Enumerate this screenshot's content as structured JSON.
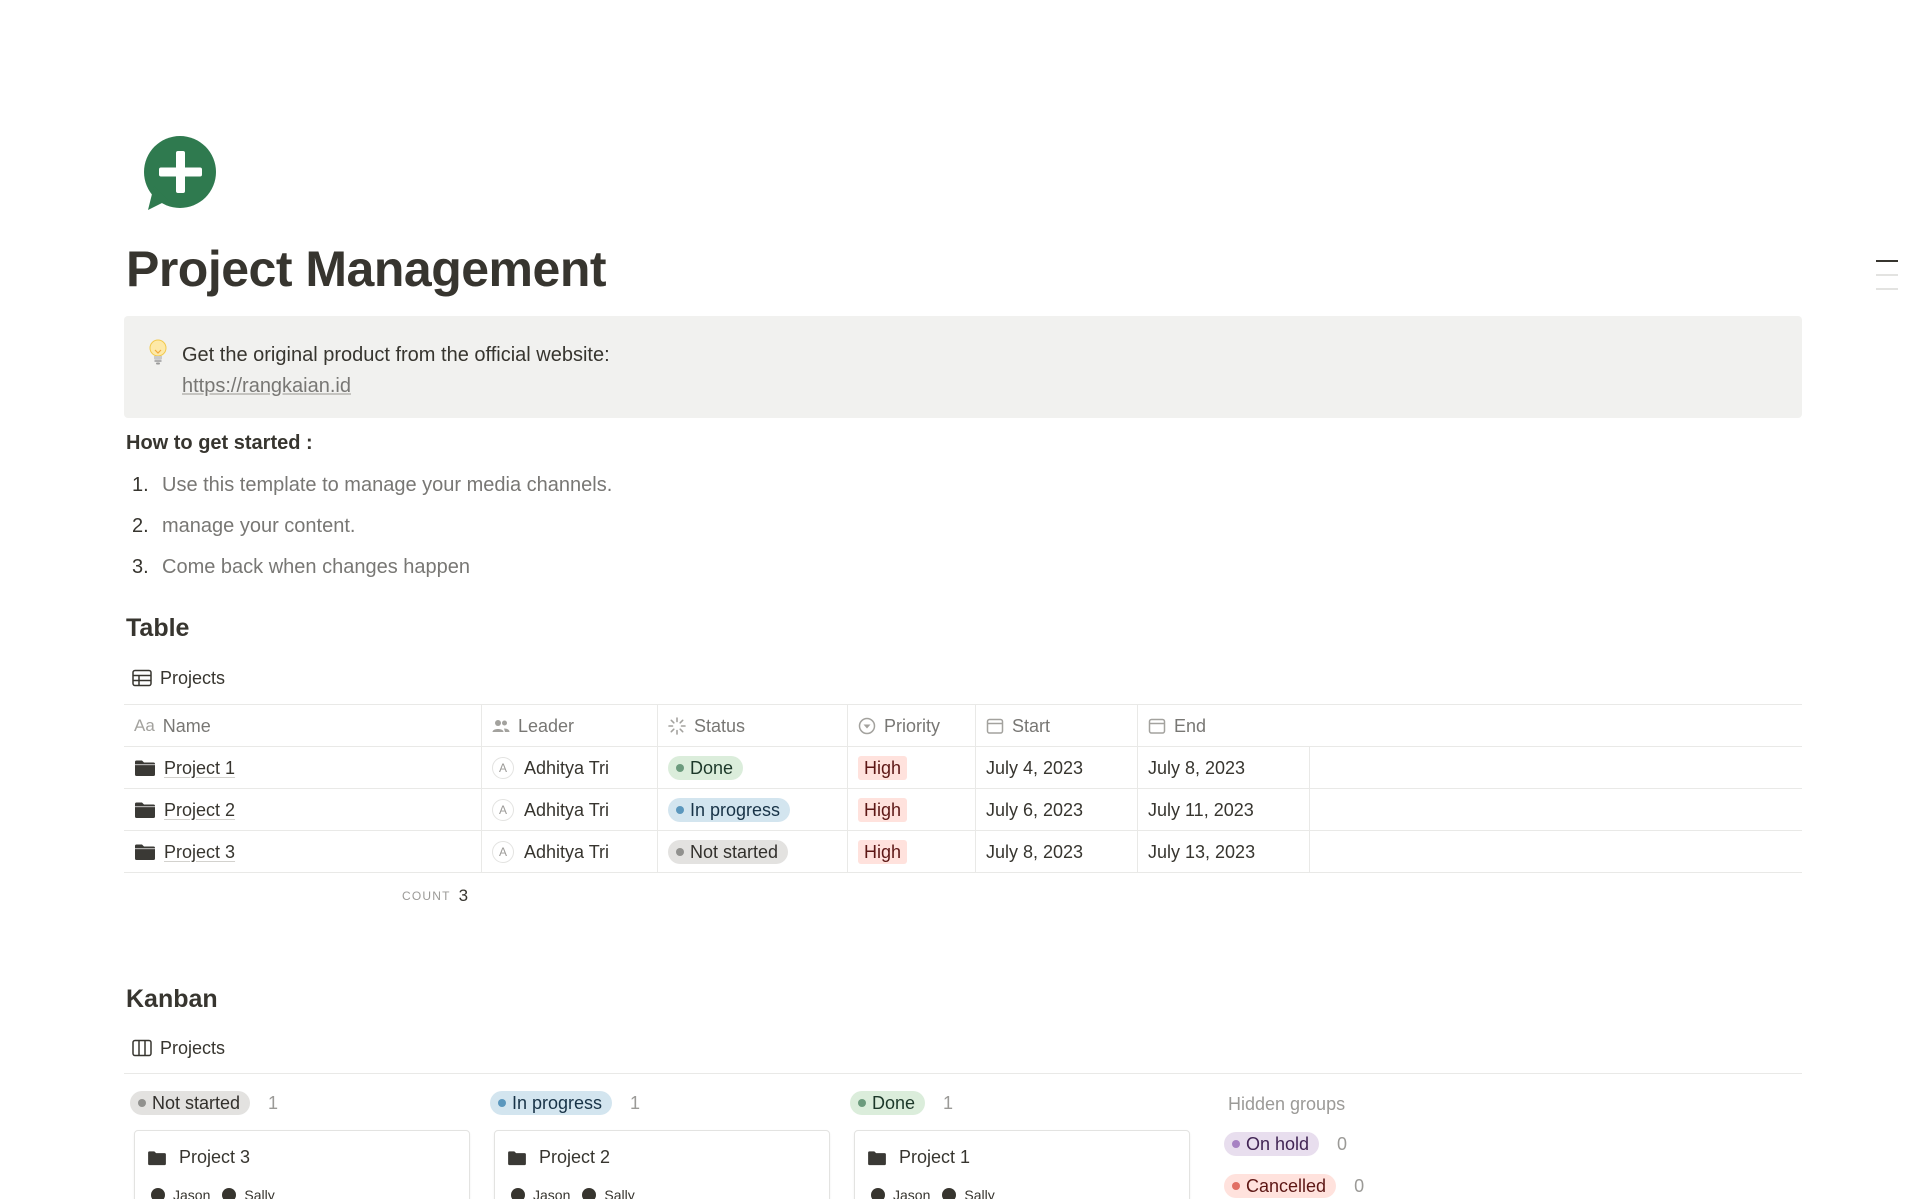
{
  "page": {
    "icon": "chat-plus-icon",
    "title": "Project Management"
  },
  "callout": {
    "icon": "lightbulb-icon",
    "text": "Get the original product from the official website:",
    "link": "https://rangkaian.id"
  },
  "getting_started": {
    "heading": "How to get started :",
    "steps": [
      {
        "num": "1.",
        "text": "Use this template to manage your media channels."
      },
      {
        "num": "2.",
        "text": "manage your content."
      },
      {
        "num": "3.",
        "text": "Come back when changes happen"
      }
    ]
  },
  "table_section": {
    "heading": "Table",
    "view_name": "Projects",
    "view_icon": "table-icon",
    "columns": {
      "name": {
        "icon": "Aa",
        "label": "Name"
      },
      "leader": {
        "icon": "people-icon",
        "label": "Leader"
      },
      "status": {
        "icon": "status-icon",
        "label": "Status"
      },
      "priority": {
        "icon": "select-icon",
        "label": "Priority"
      },
      "start": {
        "icon": "calendar-icon",
        "label": "Start"
      },
      "end": {
        "icon": "calendar-icon",
        "label": "End"
      }
    },
    "rows": [
      {
        "name": "Project 1",
        "leader_initial": "A",
        "leader": "Adhitya Tri",
        "status": "Done",
        "priority": "High",
        "start": "July 4, 2023",
        "end": "July 8, 2023"
      },
      {
        "name": "Project 2",
        "leader_initial": "A",
        "leader": "Adhitya Tri",
        "status": "In progress",
        "priority": "High",
        "start": "July 6, 2023",
        "end": "July 11, 2023"
      },
      {
        "name": "Project 3",
        "leader_initial": "A",
        "leader": "Adhitya Tri",
        "status": "Not started",
        "priority": "High",
        "start": "July 8, 2023",
        "end": "July 13, 2023"
      }
    ],
    "count_label": "COUNT",
    "count_value": "3"
  },
  "kanban_section": {
    "heading": "Kanban",
    "view_name": "Projects",
    "view_icon": "board-icon",
    "columns": [
      {
        "label": "Not started",
        "count": "1",
        "card": {
          "title": "Project 3",
          "people": [
            "Jason",
            "Sally"
          ]
        }
      },
      {
        "label": "In progress",
        "count": "1",
        "card": {
          "title": "Project 2",
          "people": [
            "Jason",
            "Sally"
          ]
        }
      },
      {
        "label": "Done",
        "count": "1",
        "card": {
          "title": "Project 1",
          "people": [
            "Jason",
            "Sally"
          ]
        }
      }
    ],
    "hidden_groups": {
      "title": "Hidden groups",
      "groups": [
        {
          "label": "On hold",
          "count": "0"
        },
        {
          "label": "Cancelled",
          "count": "0"
        }
      ]
    }
  },
  "colors": {
    "icon_green": "#2f7a4f",
    "done_bg": "#dbeddb",
    "done_dot": "#6c9b7d",
    "in_progress_bg": "#d3e5ef",
    "in_progress_dot": "#5b97bd",
    "not_started_bg": "#e3e2e0",
    "not_started_dot": "#91918e",
    "on_hold_bg": "#e8deee",
    "on_hold_dot": "#a782c3",
    "cancelled_bg": "#ffe2dd",
    "cancelled_dot": "#e16f64",
    "high_bg": "#ffe2dd",
    "high_text": "#5d1715"
  }
}
